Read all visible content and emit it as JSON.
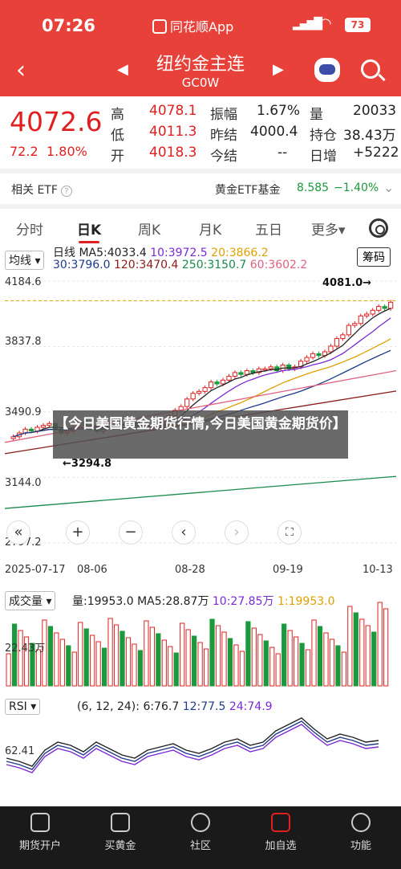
{
  "status": {
    "time": "07:26",
    "app": "同花顺App",
    "battery": "73"
  },
  "nav": {
    "title": "纽约金主连",
    "code": "GC0W"
  },
  "quote": {
    "price": "4072.6",
    "change": "72.2",
    "change_pct": "1.80%",
    "high_lbl": "高",
    "high": "4078.1",
    "low_lbl": "低",
    "low": "4011.3",
    "open_lbl": "开",
    "open": "4018.3",
    "amp_lbl": "振幅",
    "amp": "1.67%",
    "prev_lbl": "昨结",
    "prev": "4000.4",
    "settle_lbl": "今结",
    "settle": "--",
    "vol_lbl": "量",
    "vol": "20033",
    "oi_lbl": "持仓",
    "oi": "38.43万",
    "oi_chg_lbl": "日增",
    "oi_chg": "+5222"
  },
  "etf": {
    "label": "相关 ETF",
    "fund": "黄金ETF基金",
    "value": "8.585",
    "pct": "−1.40%"
  },
  "tabs": [
    "分时",
    "日K",
    "周K",
    "月K",
    "五日",
    "更多▾"
  ],
  "active_tab": "日K",
  "kchart": {
    "ma_select": "均线",
    "overlay_btn": "筹码",
    "line1": {
      "a": "日线",
      "ma5": "MA5:4033.4",
      "ma10": "10:3972.5",
      "ma20": "20:3866.2"
    },
    "line2": {
      "ma30": "30:3796.0",
      "ma120": "120:3470.4",
      "ma250": "250:3150.7",
      "ma60": "60:3602.2"
    },
    "y_ticks": [
      "4184.6",
      "3837.8",
      "3490.9",
      "3144.0",
      "2797.2"
    ],
    "x_ticks": [
      "2025-07-17",
      "08-06",
      "08-28",
      "09-19",
      "10-13"
    ],
    "high_annot": "4081.0→",
    "low_annot": "←3294.8",
    "news_overlay": "【今日美国黄金期货行情,今日美国黄金期货价】"
  },
  "volume": {
    "select": "成交量",
    "v": "量:19953.0",
    "ma5": "MA5:28.87万",
    "ma10": "10:27.85万",
    "ma1": "1:19953.0",
    "axis": "22.43万"
  },
  "rsi": {
    "select": "RSI",
    "params": "(6, 12, 24):",
    "r6": "6:76.7",
    "r12": "12:77.5",
    "r24": "24:74.9",
    "axis": "62.41"
  },
  "bottom_nav": [
    "期货开户",
    "买黄金",
    "社区",
    "加自选",
    "功能"
  ],
  "colors": {
    "accent": "#e8413a",
    "up": "#e02020",
    "down": "#1a9a3c"
  },
  "chart_data": {
    "type": "candlestick",
    "title": "",
    "xlabel": "",
    "ylabel": "",
    "ylim": [
      2797.2,
      4184.6
    ],
    "x": [
      "2025-07-17",
      "08-06",
      "08-28",
      "09-19",
      "10-13"
    ],
    "closes": [
      3360,
      3380,
      3400,
      3390,
      3410,
      3420,
      3430,
      3400,
      3380,
      3390,
      3410,
      3440,
      3420,
      3400,
      3390,
      3410,
      3430,
      3450,
      3440,
      3420,
      3430,
      3410,
      3400,
      3410,
      3420,
      3440,
      3470,
      3500,
      3520,
      3560,
      3590,
      3600,
      3620,
      3650,
      3640,
      3660,
      3680,
      3700,
      3690,
      3710,
      3700,
      3720,
      3720,
      3730,
      3710,
      3740,
      3720,
      3730,
      3760,
      3780,
      3800,
      3790,
      3810,
      3840,
      3880,
      3900,
      3950,
      3960,
      4000,
      4010,
      4030,
      4050,
      4040,
      4072.6
    ],
    "max_label": 4081.0,
    "min_label": 3294.8
  }
}
